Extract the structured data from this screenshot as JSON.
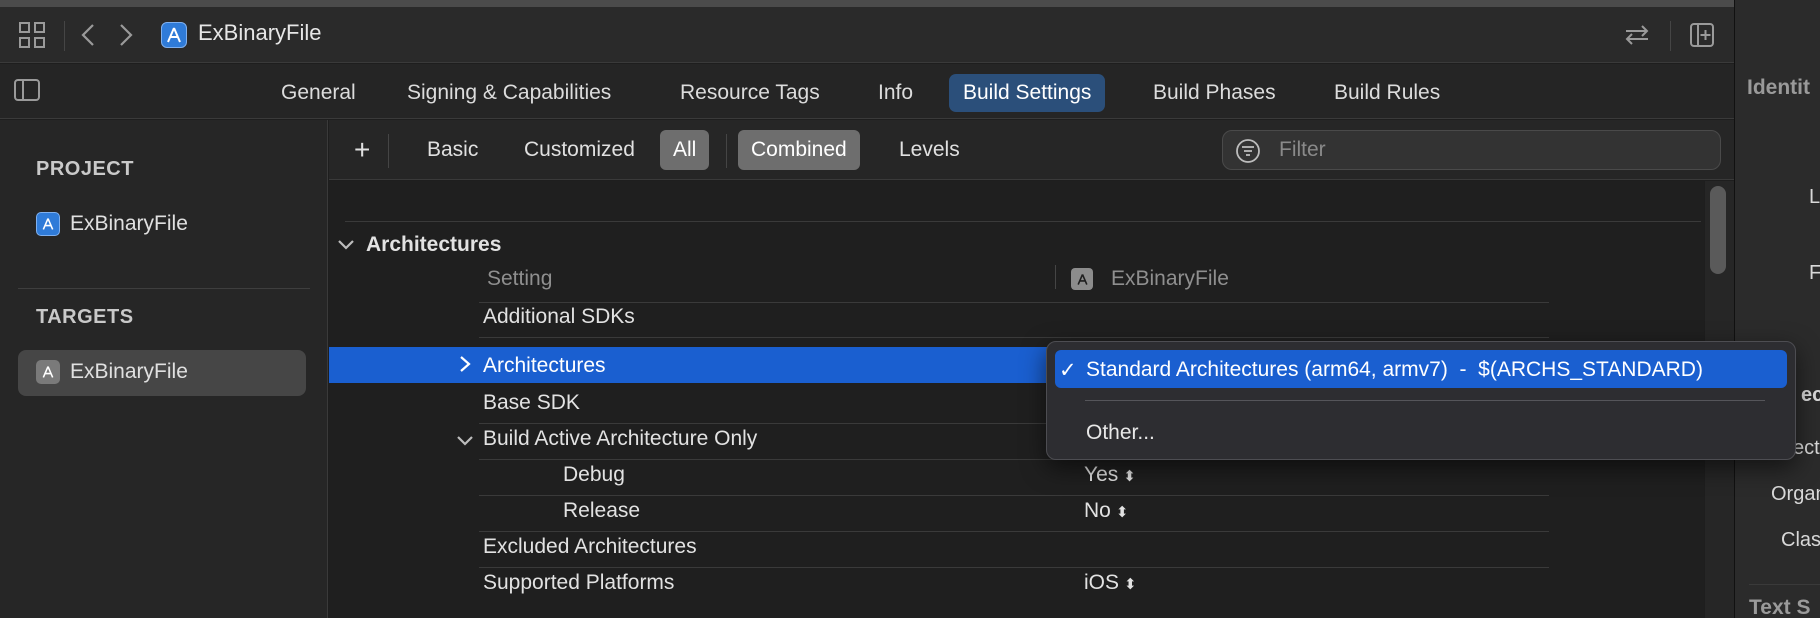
{
  "toolbar": {
    "file_name": "ExBinaryFile",
    "icons": [
      "grid-icon",
      "back-chevron-icon",
      "forward-chevron-icon",
      "swap-arrows-icon",
      "add-editor-icon"
    ]
  },
  "tabs": [
    {
      "label": "General"
    },
    {
      "label": "Signing & Capabilities"
    },
    {
      "label": "Resource Tags"
    },
    {
      "label": "Info"
    },
    {
      "label": "Build Settings",
      "active": true
    },
    {
      "label": "Build Phases"
    },
    {
      "label": "Build Rules"
    }
  ],
  "sidebar": {
    "project_header": "PROJECT",
    "project_item": "ExBinaryFile",
    "targets_header": "TARGETS",
    "target_item": "ExBinaryFile"
  },
  "filterbar": {
    "add_label": "+",
    "basic": "Basic",
    "customized": "Customized",
    "all": "All",
    "combined": "Combined",
    "levels": "Levels",
    "filter_placeholder": "Filter"
  },
  "settings": {
    "section_title": "Architectures",
    "col_setting": "Setting",
    "col_target": "ExBinaryFile",
    "rows": [
      {
        "name": "Additional SDKs",
        "value": ""
      },
      {
        "name": "Architectures",
        "value": "",
        "selected": true
      },
      {
        "name": "Base SDK",
        "value": ""
      },
      {
        "name": "Build Active Architecture Only",
        "value": ""
      },
      {
        "name": "Debug",
        "value": "Yes"
      },
      {
        "name": "Release",
        "value": "No"
      },
      {
        "name": "Excluded Architectures",
        "value": ""
      },
      {
        "name": "Supported Platforms",
        "value": "iOS"
      }
    ]
  },
  "popup": {
    "checkmark": "✓",
    "option_selected": "Standard Architectures (arm64, armv7)  -  $(ARCHS_STANDARD)",
    "option_other": "Other..."
  },
  "inspector": {
    "title": "Identit",
    "l": "L",
    "f": "F",
    "ec": "ec",
    "ect": "ect",
    "organ": "Organ",
    "clas": "Clas",
    "text_s": "Text S"
  },
  "colors": {
    "accent": "#1a5fd0",
    "active_tab": "#2b4f7a"
  }
}
